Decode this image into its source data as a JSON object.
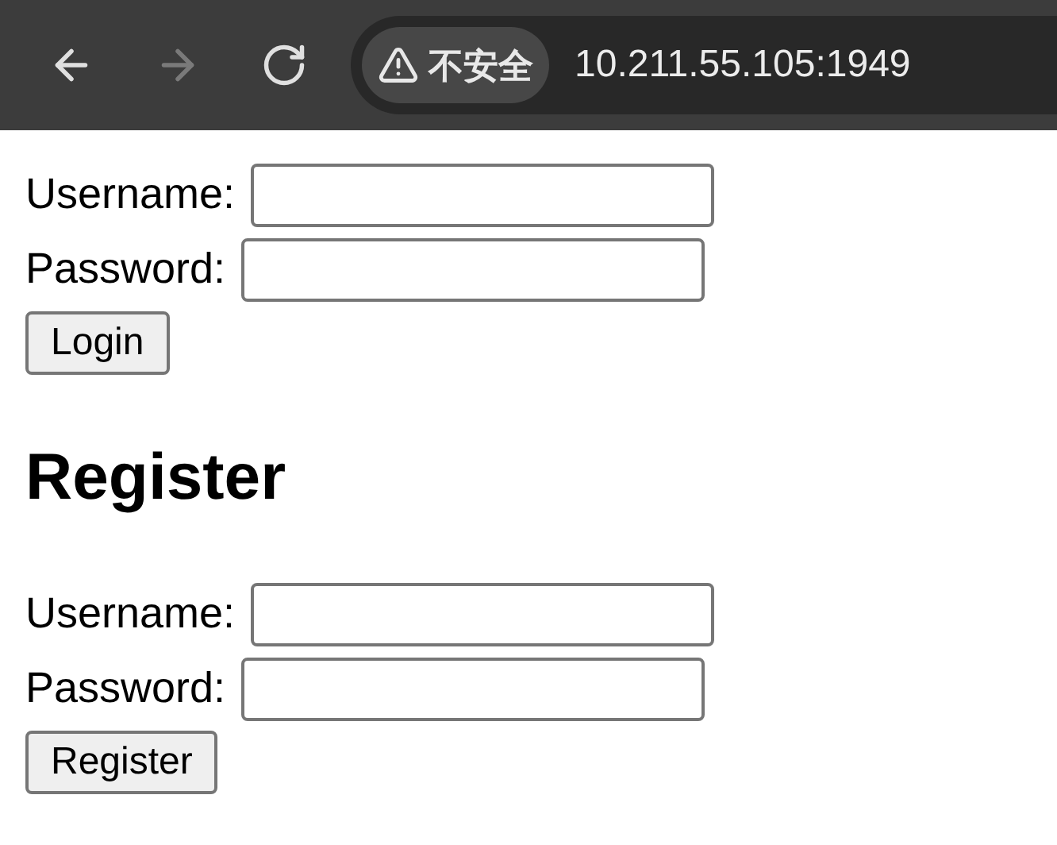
{
  "toolbar": {
    "nav_buttons": [
      {
        "kind": "back",
        "disabled": false
      },
      {
        "kind": "forward",
        "disabled": true
      },
      {
        "kind": "reload",
        "disabled": false
      }
    ],
    "security_chip": "不安全",
    "url": "10.211.55.105:1949"
  },
  "login_form": {
    "fields": [
      {
        "label": "Username:"
      },
      {
        "label": "Password:"
      }
    ],
    "button": "Login"
  },
  "register_heading": "Register",
  "register_form": {
    "fields": [
      {
        "label": "Username:"
      },
      {
        "label": "Password:"
      }
    ],
    "button": "Register"
  }
}
